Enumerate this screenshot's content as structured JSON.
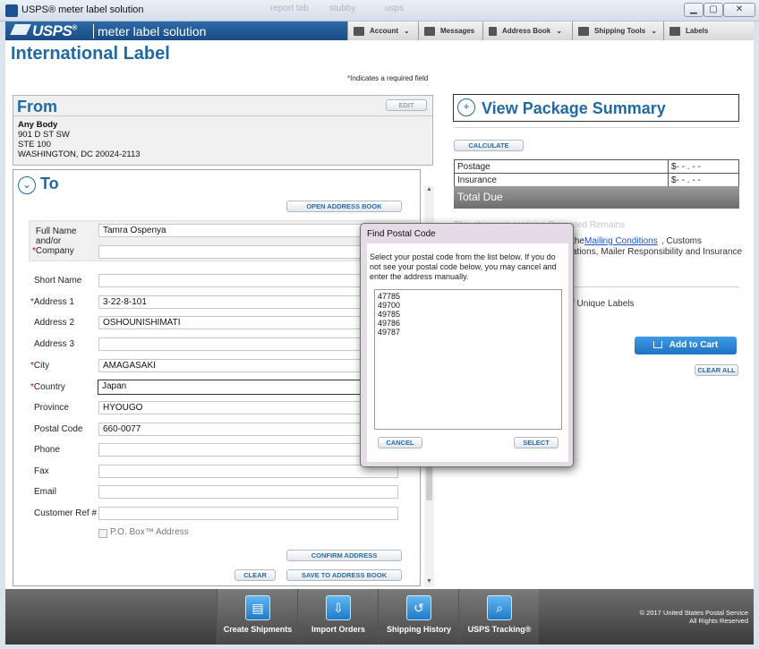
{
  "window": {
    "title": "USPS® meter label solution",
    "minimize": "▁",
    "maximize": "▢",
    "close": "✕",
    "background_tabs": [
      "report tab",
      "stubby",
      "usps"
    ]
  },
  "header": {
    "logo": "USPS",
    "logo_mark": "®",
    "app_name": "meter label solution",
    "menu": [
      {
        "label": "Account",
        "icon": "account-icon",
        "dropdown": true
      },
      {
        "label": "Messages",
        "icon": "envelope-icon",
        "dropdown": false
      },
      {
        "label": "Address Book",
        "icon": "address-book-icon",
        "dropdown": true
      },
      {
        "label": "Shipping Tools",
        "icon": "tools-icon",
        "dropdown": true
      },
      {
        "label": "Labels",
        "icon": "cart-icon",
        "dropdown": false
      }
    ]
  },
  "page": {
    "title": "International Label",
    "required_note_star": "*",
    "required_note": "Indicates a required field"
  },
  "from": {
    "heading": "From",
    "edit_label": "EDIT",
    "lines": [
      "Any Body",
      "901 D ST SW",
      "STE 100",
      "WASHINGTON, DC 20024-2113"
    ]
  },
  "to": {
    "heading": "To",
    "toggle_symbol": "⌄",
    "open_address_book": "OPEN ADDRESS BOOK",
    "fields": {
      "full_name": {
        "label": "Full Name and/or Company",
        "value": "Tamra Ospenya"
      },
      "company": {
        "value": ""
      },
      "short_name": {
        "label": "Short Name",
        "value": ""
      },
      "address1": {
        "label": "Address 1",
        "value": "3-22-8-101"
      },
      "address2": {
        "label": "Address 2",
        "value": "OSHOUNISHIMATI"
      },
      "address3": {
        "label": "Address 3",
        "value": ""
      },
      "city": {
        "label": "City",
        "value": "AMAGASAKI"
      },
      "country": {
        "label": "Country",
        "value": "Japan"
      },
      "province": {
        "label": "Province",
        "value": "HYOUGO"
      },
      "postal_code": {
        "label": "Postal Code",
        "value": "660-0077"
      },
      "phone": {
        "label": "Phone",
        "value": ""
      },
      "fax": {
        "label": "Fax",
        "value": ""
      },
      "email": {
        "label": "Email",
        "value": ""
      },
      "customer_ref": {
        "label": "Customer Ref #",
        "value": ""
      }
    },
    "po_box_label": "P.O. Box™ Address",
    "confirm_address": "CONFIRM ADDRESS",
    "clear": "CLEAR",
    "save_to_address_book": "SAVE TO ADDRESS BOOK"
  },
  "summary": {
    "heading": "View Package Summary",
    "toggle_symbol": "+",
    "calculate": "CALCULATE",
    "postage_label": "Postage",
    "postage_value": "$- - . - -",
    "insurance_label": "Insurance",
    "insurance_value": "$- - . - -",
    "total_label": "Total Due",
    "behind_text_1": "This shipment contains Cremated Remains",
    "behind_text_2a": "the",
    "mailing_conditions_link": "Mailing Conditions",
    "behind_text_2b": ", Customs",
    "behind_text_3": "ations, Mailer Responsibility and Insurance",
    "behind_text_4": "f Unique Labels",
    "add_to_cart": "Add to Cart",
    "clear_all": "CLEAR ALL"
  },
  "dialog": {
    "title": "Find Postal Code",
    "instructions": "Select your postal code from the list below. If you do not see your postal code below, you may cancel and enter the address manually.",
    "postal_codes": [
      "47785",
      "49700",
      "49785",
      "49786",
      "49787"
    ],
    "cancel": "CANCEL",
    "select": "SELECT"
  },
  "bottom_nav": [
    {
      "label": "Create Shipments",
      "icon": "create-shipments-icon"
    },
    {
      "label": "Import Orders",
      "icon": "import-orders-icon"
    },
    {
      "label": "Shipping History",
      "icon": "shipping-history-icon"
    },
    {
      "label": "USPS Tracking®",
      "icon": "usps-tracking-icon"
    }
  ],
  "footer": {
    "copyright": "© 2017 United States Postal Service",
    "rights": "All Rights Reserved"
  },
  "colors": {
    "brand_blue": "#1f6aa5",
    "header_blue": "#1a4c84",
    "required_red": "#cc0000",
    "cart_blue": "#1c73c6"
  }
}
